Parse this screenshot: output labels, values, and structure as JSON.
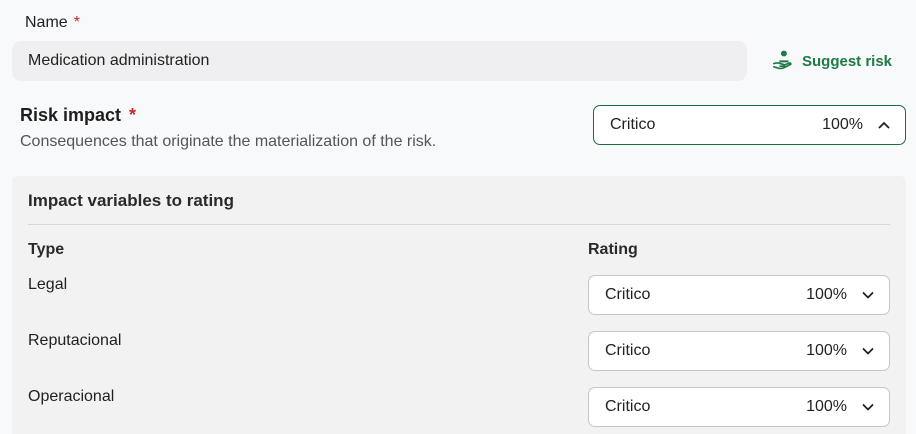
{
  "name_field": {
    "label": "Name",
    "required_mark": "*",
    "value": "Medication administration"
  },
  "suggest": {
    "label": "Suggest risk",
    "icon": "hand-person-icon",
    "color": "#1f7a45"
  },
  "risk_impact": {
    "title": "Risk impact",
    "required_mark": "*",
    "description": "Consequences that originate the materialization of the risk.",
    "select": {
      "value": "Critico",
      "percent": "100%",
      "state": "expanded"
    }
  },
  "panel": {
    "title": "Impact variables to rating",
    "col_type": "Type",
    "col_rating": "Rating",
    "rows": [
      {
        "type": "Legal",
        "rating": "Critico",
        "percent": "100%"
      },
      {
        "type": "Reputacional",
        "rating": "Critico",
        "percent": "100%"
      },
      {
        "type": "Operacional",
        "rating": "Critico",
        "percent": "100%"
      }
    ]
  },
  "colors": {
    "accent_green": "#1f6b3e",
    "required_red": "#c62828"
  }
}
